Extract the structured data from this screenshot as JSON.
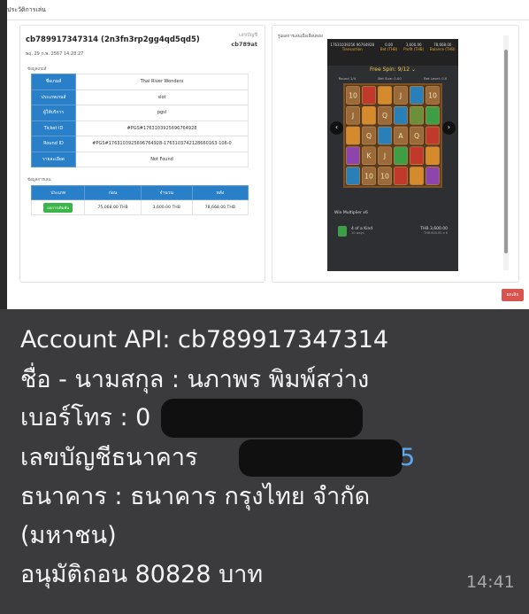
{
  "modal": {
    "title": "ประวัติการเล่น",
    "account_title": "cb789917347314 (2n3fn3rp2gg4qd5qd5)",
    "date": "พฤ, 29 ก.พ. 2567 14:28:27",
    "account_label": "เลขบัญชี",
    "account_short": "cb789at",
    "section_info": "ข้อมูลเกมส์",
    "info_rows": [
      {
        "key": "ชื่อเกมส์",
        "value": "Thai River Wonders"
      },
      {
        "key": "ประเภทเกมส์",
        "value": "slot"
      },
      {
        "key": "ผู้ให้บริการ",
        "value": "pgsl"
      },
      {
        "key": "Ticket ID",
        "value": "#PGS#1763103925696764928"
      },
      {
        "key": "Round ID",
        "value": "#PGS#1763103925696764928-1763103742128660163-106-0"
      },
      {
        "key": "รายละเอียด",
        "value": "Not Found"
      }
    ],
    "section_trx": "ข้อมูลการเล่น",
    "trx_headers": [
      "ประเภท",
      "ก่อน",
      "จำนวน",
      "หลัง"
    ],
    "trx_rows": [
      {
        "type": "ผลการเดิมพัน",
        "before": "75,068.00 THB",
        "amount": "3,600.00 THB",
        "after": "78,668.00 THB"
      }
    ],
    "right_label": "รูปผลการเล่นเมื่อเลื่อนหลัง",
    "close_label": "ยกเลิก"
  },
  "game": {
    "stats": [
      {
        "value": "17631039256 96764928",
        "label": "Transaction"
      },
      {
        "value": "0.00",
        "label": "Bet (THB)"
      },
      {
        "value": "3,600.00",
        "label": "Profit (THB)"
      },
      {
        "value": "78,668.00",
        "label": "Balance (THB)"
      }
    ],
    "free_spin": "Free Spin: 9/12",
    "sub_labels": [
      "Round 1/4",
      "Bet Size: 0.00",
      "Bet Level: 0.0"
    ],
    "reel_symbols": [
      [
        "10",
        "J",
        "",
        "",
        ""
      ],
      [
        "",
        "",
        "Q",
        "K",
        "10"
      ],
      [
        "",
        "Q",
        "",
        "J",
        "10"
      ],
      [
        "J",
        "",
        "A",
        "",
        ""
      ],
      [
        "",
        "",
        "Q",
        "",
        ""
      ],
      [
        "10",
        "",
        "",
        "",
        ""
      ]
    ],
    "win_title": "Win Multiplier x6",
    "win_kind": "4 of a Kind",
    "win_sub": "10 ways",
    "win_amount": "THB 3,600.00",
    "win_amount_sub": "THB 600.00 x 6"
  },
  "chat": {
    "line1": "Account API: cb789917347314",
    "line2": "ชื่อ - นามสกุล : นภาพร พิมพ์สว่าง",
    "line3_prefix": "เบอร์โทร : 0",
    "line4_prefix": "เลขบัญชีธนาคาร",
    "line4_tail": "5",
    "line5": "ธนาคาร : ธนาคาร กรุงไทย จำกัด",
    "line6": "(มหาชน)",
    "line7": "อนุมัติถอน 80828 บาท",
    "timestamp": "14:41"
  },
  "colors": {
    "table_header": "#2a7fc9",
    "badge": "#3bb54a",
    "close_button": "#d9534f",
    "chat_bg": "#3b3b3d",
    "link_blue": "#5aa8ee"
  }
}
